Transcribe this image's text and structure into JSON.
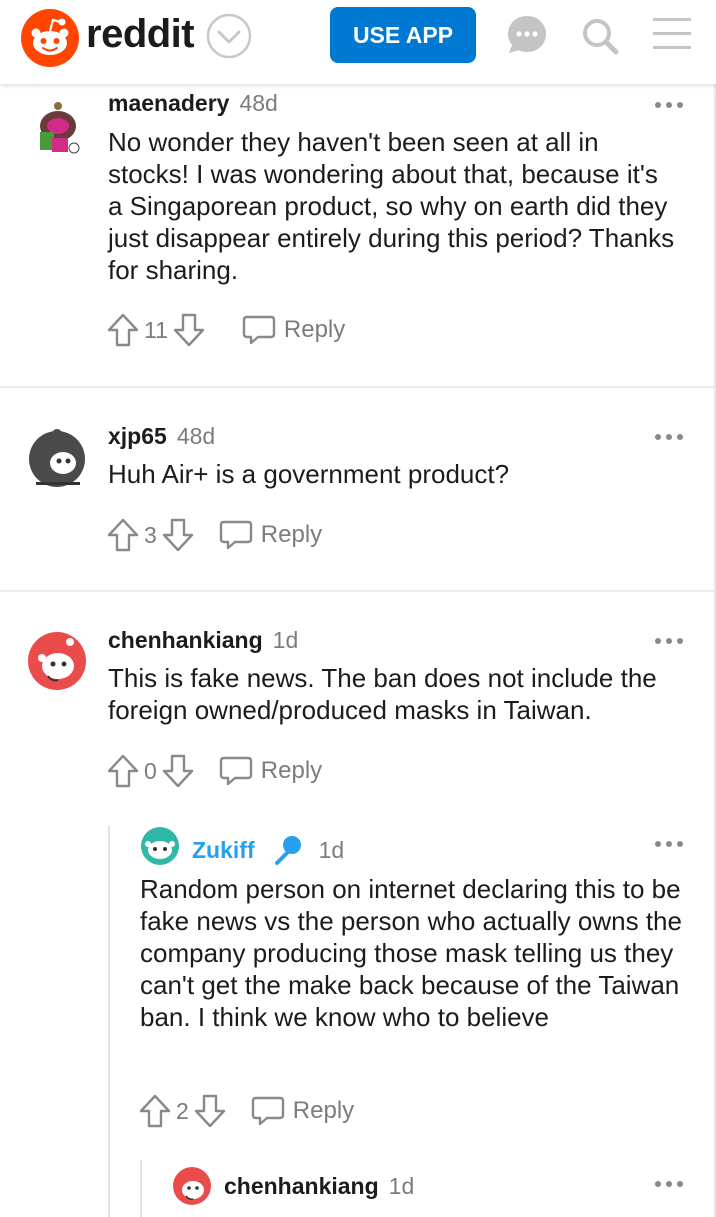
{
  "header": {
    "logo_text": "reddit",
    "use_app_label": "USE APP"
  },
  "comments": [
    {
      "author": "maenadery",
      "age": "48d",
      "text": "No wonder they haven't been seen at all in stocks! I was wondering about that, because it's a Singaporean product, so why on earth did they just disappear entirely during this period? Thanks for sharing.",
      "votes": "11",
      "reply_label": "Reply"
    },
    {
      "author": "xjp65",
      "age": "48d",
      "text": "Huh Air+ is a government product?",
      "votes": "3",
      "reply_label": "Reply"
    },
    {
      "author": "chenhankiang",
      "age": "1d",
      "text": "This is fake news. The ban does not include the foreign owned/produced masks in Taiwan.",
      "votes": "0",
      "reply_label": "Reply"
    },
    {
      "author": "Zukiff",
      "age": "1d",
      "text": "Random person on internet declaring this to be fake news vs the person who actually owns the company producing those mask telling us they can't get the make back because of the Taiwan ban. I think we know who to believe",
      "votes": "2",
      "reply_label": "Reply"
    },
    {
      "author": "chenhankiang",
      "age": "1d"
    }
  ],
  "colors": {
    "brand": "#ff4500",
    "use_app": "#0079d3",
    "op_author": "#24a0ed",
    "muted": "#7c7c7c"
  },
  "icons": [
    "snoo-logo-icon",
    "chevron-down-icon",
    "chat-icon",
    "search-icon",
    "menu-icon",
    "more-icon",
    "upvote-icon",
    "downvote-icon",
    "reply-icon",
    "microphone-icon"
  ]
}
